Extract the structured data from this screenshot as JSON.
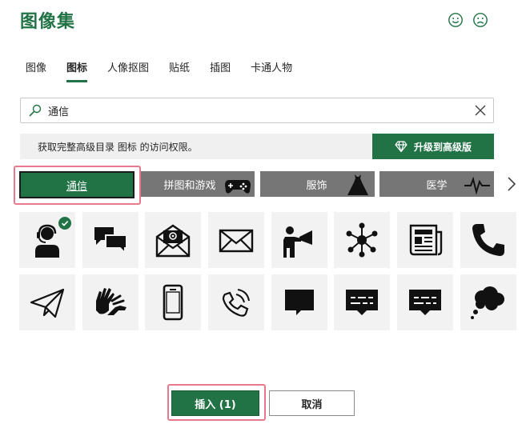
{
  "dialog": {
    "title": "图像集",
    "accent_color": "#217346"
  },
  "feedback": {
    "smile_icon": "smile-face-icon",
    "frown_icon": "frown-face-icon"
  },
  "tabs": [
    {
      "label": "图像",
      "active": false
    },
    {
      "label": "图标",
      "active": true
    },
    {
      "label": "人像抠图",
      "active": false
    },
    {
      "label": "贴纸",
      "active": false
    },
    {
      "label": "插图",
      "active": false
    },
    {
      "label": "卡通人物",
      "active": false
    }
  ],
  "search": {
    "value": "通信",
    "icon": "search-icon",
    "clear_icon": "close-icon"
  },
  "banner": {
    "text": "获取完整高级目录 图标 的访问权限。",
    "upgrade_label": "升级到高级版",
    "upgrade_icon": "diamond-icon"
  },
  "categories": [
    {
      "label": "通信",
      "selected": true,
      "icon": ""
    },
    {
      "label": "拼图和游戏",
      "selected": false,
      "icon": "gamepad-icon"
    },
    {
      "label": "服饰",
      "selected": false,
      "icon": "dress-icon"
    },
    {
      "label": "医学",
      "selected": false,
      "icon": "heartbeat-icon"
    }
  ],
  "icons": [
    {
      "name": "call-center-agent-icon",
      "selected": true
    },
    {
      "name": "chat-bubbles-icon",
      "selected": false
    },
    {
      "name": "email-envelope-icon",
      "selected": false
    },
    {
      "name": "envelope-icon",
      "selected": false
    },
    {
      "name": "megaphone-person-icon",
      "selected": false
    },
    {
      "name": "network-hub-icon",
      "selected": false
    },
    {
      "name": "newspaper-icon",
      "selected": false
    },
    {
      "name": "phone-handset-icon",
      "selected": false
    },
    {
      "name": "paper-plane-icon",
      "selected": false
    },
    {
      "name": "sign-language-icon",
      "selected": false
    },
    {
      "name": "mobile-phone-icon",
      "selected": false
    },
    {
      "name": "phone-ringing-icon",
      "selected": false
    },
    {
      "name": "speech-bubble-icon",
      "selected": false
    },
    {
      "name": "text-message-icon",
      "selected": false
    },
    {
      "name": "text-message-2-icon",
      "selected": false
    },
    {
      "name": "thought-bubble-icon",
      "selected": false
    }
  ],
  "footer": {
    "insert_label": "插入 (1)",
    "cancel_label": "取消"
  }
}
